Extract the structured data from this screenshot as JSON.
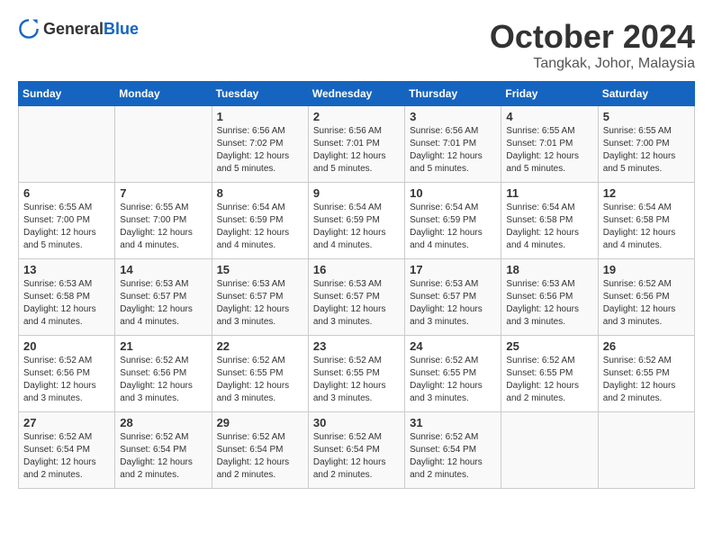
{
  "header": {
    "logo_general": "General",
    "logo_blue": "Blue",
    "month": "October 2024",
    "location": "Tangkak, Johor, Malaysia"
  },
  "days_of_week": [
    "Sunday",
    "Monday",
    "Tuesday",
    "Wednesday",
    "Thursday",
    "Friday",
    "Saturday"
  ],
  "weeks": [
    [
      {
        "day": "",
        "info": ""
      },
      {
        "day": "",
        "info": ""
      },
      {
        "day": "1",
        "info": "Sunrise: 6:56 AM\nSunset: 7:02 PM\nDaylight: 12 hours\nand 5 minutes."
      },
      {
        "day": "2",
        "info": "Sunrise: 6:56 AM\nSunset: 7:01 PM\nDaylight: 12 hours\nand 5 minutes."
      },
      {
        "day": "3",
        "info": "Sunrise: 6:56 AM\nSunset: 7:01 PM\nDaylight: 12 hours\nand 5 minutes."
      },
      {
        "day": "4",
        "info": "Sunrise: 6:55 AM\nSunset: 7:01 PM\nDaylight: 12 hours\nand 5 minutes."
      },
      {
        "day": "5",
        "info": "Sunrise: 6:55 AM\nSunset: 7:00 PM\nDaylight: 12 hours\nand 5 minutes."
      }
    ],
    [
      {
        "day": "6",
        "info": "Sunrise: 6:55 AM\nSunset: 7:00 PM\nDaylight: 12 hours\nand 5 minutes."
      },
      {
        "day": "7",
        "info": "Sunrise: 6:55 AM\nSunset: 7:00 PM\nDaylight: 12 hours\nand 4 minutes."
      },
      {
        "day": "8",
        "info": "Sunrise: 6:54 AM\nSunset: 6:59 PM\nDaylight: 12 hours\nand 4 minutes."
      },
      {
        "day": "9",
        "info": "Sunrise: 6:54 AM\nSunset: 6:59 PM\nDaylight: 12 hours\nand 4 minutes."
      },
      {
        "day": "10",
        "info": "Sunrise: 6:54 AM\nSunset: 6:59 PM\nDaylight: 12 hours\nand 4 minutes."
      },
      {
        "day": "11",
        "info": "Sunrise: 6:54 AM\nSunset: 6:58 PM\nDaylight: 12 hours\nand 4 minutes."
      },
      {
        "day": "12",
        "info": "Sunrise: 6:54 AM\nSunset: 6:58 PM\nDaylight: 12 hours\nand 4 minutes."
      }
    ],
    [
      {
        "day": "13",
        "info": "Sunrise: 6:53 AM\nSunset: 6:58 PM\nDaylight: 12 hours\nand 4 minutes."
      },
      {
        "day": "14",
        "info": "Sunrise: 6:53 AM\nSunset: 6:57 PM\nDaylight: 12 hours\nand 4 minutes."
      },
      {
        "day": "15",
        "info": "Sunrise: 6:53 AM\nSunset: 6:57 PM\nDaylight: 12 hours\nand 3 minutes."
      },
      {
        "day": "16",
        "info": "Sunrise: 6:53 AM\nSunset: 6:57 PM\nDaylight: 12 hours\nand 3 minutes."
      },
      {
        "day": "17",
        "info": "Sunrise: 6:53 AM\nSunset: 6:57 PM\nDaylight: 12 hours\nand 3 minutes."
      },
      {
        "day": "18",
        "info": "Sunrise: 6:53 AM\nSunset: 6:56 PM\nDaylight: 12 hours\nand 3 minutes."
      },
      {
        "day": "19",
        "info": "Sunrise: 6:52 AM\nSunset: 6:56 PM\nDaylight: 12 hours\nand 3 minutes."
      }
    ],
    [
      {
        "day": "20",
        "info": "Sunrise: 6:52 AM\nSunset: 6:56 PM\nDaylight: 12 hours\nand 3 minutes."
      },
      {
        "day": "21",
        "info": "Sunrise: 6:52 AM\nSunset: 6:56 PM\nDaylight: 12 hours\nand 3 minutes."
      },
      {
        "day": "22",
        "info": "Sunrise: 6:52 AM\nSunset: 6:55 PM\nDaylight: 12 hours\nand 3 minutes."
      },
      {
        "day": "23",
        "info": "Sunrise: 6:52 AM\nSunset: 6:55 PM\nDaylight: 12 hours\nand 3 minutes."
      },
      {
        "day": "24",
        "info": "Sunrise: 6:52 AM\nSunset: 6:55 PM\nDaylight: 12 hours\nand 3 minutes."
      },
      {
        "day": "25",
        "info": "Sunrise: 6:52 AM\nSunset: 6:55 PM\nDaylight: 12 hours\nand 2 minutes."
      },
      {
        "day": "26",
        "info": "Sunrise: 6:52 AM\nSunset: 6:55 PM\nDaylight: 12 hours\nand 2 minutes."
      }
    ],
    [
      {
        "day": "27",
        "info": "Sunrise: 6:52 AM\nSunset: 6:54 PM\nDaylight: 12 hours\nand 2 minutes."
      },
      {
        "day": "28",
        "info": "Sunrise: 6:52 AM\nSunset: 6:54 PM\nDaylight: 12 hours\nand 2 minutes."
      },
      {
        "day": "29",
        "info": "Sunrise: 6:52 AM\nSunset: 6:54 PM\nDaylight: 12 hours\nand 2 minutes."
      },
      {
        "day": "30",
        "info": "Sunrise: 6:52 AM\nSunset: 6:54 PM\nDaylight: 12 hours\nand 2 minutes."
      },
      {
        "day": "31",
        "info": "Sunrise: 6:52 AM\nSunset: 6:54 PM\nDaylight: 12 hours\nand 2 minutes."
      },
      {
        "day": "",
        "info": ""
      },
      {
        "day": "",
        "info": ""
      }
    ]
  ]
}
